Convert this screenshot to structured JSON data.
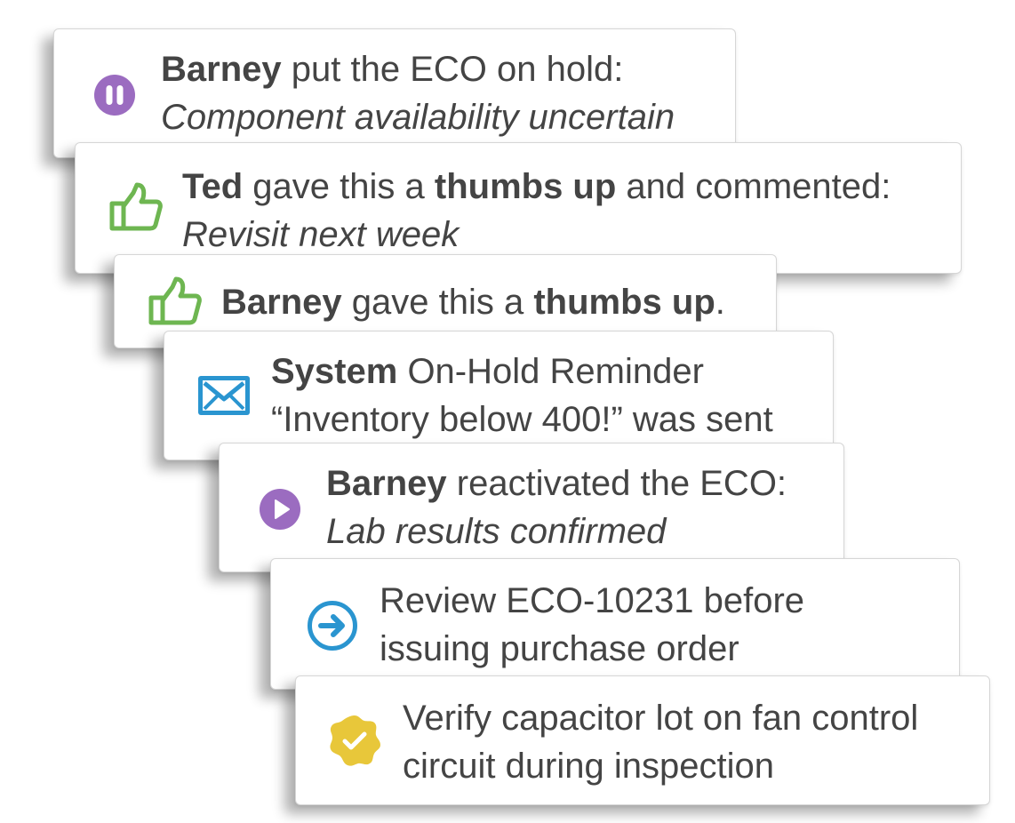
{
  "colors": {
    "purple": "#9b6cc0",
    "green": "#6eb651",
    "blue": "#2a95d0",
    "yellow": "#e8c73a",
    "text": "#444444"
  },
  "activity": [
    {
      "icon": "pause-circle-icon",
      "actor": "Barney",
      "action": "put the ECO on hold:",
      "note": "Component availability uncertain"
    },
    {
      "icon": "thumbs-up-icon",
      "actor": "Ted",
      "action_1": "gave this a",
      "emphasis": "thumbs up",
      "action_2": "and commented:",
      "note": "Revisit next week"
    },
    {
      "icon": "thumbs-up-icon",
      "actor": "Barney",
      "action_1": "gave this a",
      "emphasis": "thumbs up",
      "action_2": "."
    },
    {
      "icon": "envelope-icon",
      "actor": "System",
      "action": "On-Hold Reminder",
      "detail": "“Inventory below 400!” was sent"
    },
    {
      "icon": "play-circle-icon",
      "actor": "Barney",
      "action": "reactivated the ECO:",
      "note": "Lab results confirmed"
    },
    {
      "icon": "arrow-right-circle-icon",
      "line_1": "Review ECO-10231 before",
      "line_2": "issuing purchase order"
    },
    {
      "icon": "check-badge-icon",
      "line_1": "Verify capacitor lot on fan control",
      "line_2": "circuit during inspection"
    }
  ]
}
